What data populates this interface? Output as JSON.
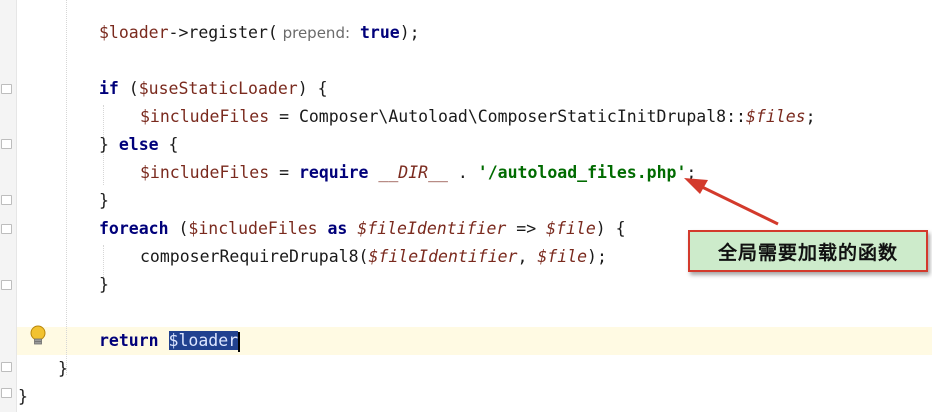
{
  "editor": {
    "code": {
      "l1_var": "$loader",
      "l1_arrow": "->register(",
      "l1_hint": " prepend:",
      "l1_true": " true",
      "l1_end": ");",
      "l2_if": "if",
      "l2_open": " (",
      "l2_var": "$useStaticLoader",
      "l2_close": ") {",
      "l3_var": "$includeFiles",
      "l3_eq": " = Composer\\Autoload\\ComposerStaticInitDrupal8::",
      "l3_files": "$files",
      "l3_end": ";",
      "l4_brace": "} ",
      "l4_else": "else",
      "l4_open": " {",
      "l5_var": "$includeFiles",
      "l5_eq": " = ",
      "l5_require": "require",
      "l5_dir": " __DIR__",
      "l5_dot": " . ",
      "l5_str": "'/autoload_files.php'",
      "l5_end": ";",
      "l6_close": "}",
      "l7_foreach": "foreach",
      "l7_open": " (",
      "l7_var1": "$includeFiles",
      "l7_as": " as ",
      "l7_var2": "$fileIdentifier",
      "l7_arrow": " => ",
      "l7_var3": "$file",
      "l7_close": ") {",
      "l8_fn": "composerRequireDrupal8(",
      "l8_var1": "$fileIdentifier",
      "l8_comma": ", ",
      "l8_var2": "$file",
      "l8_end": ");",
      "l9_close": "}",
      "l10_return": "return",
      "l10_var": "$loader",
      "l11_close": "}",
      "l12_close": "}"
    },
    "annotation": {
      "text": "全局需要加载的函数",
      "border_color": "#d33a2c",
      "fill_color": "#cdebcb"
    },
    "icons": {
      "lightbulb": "lightbulb-icon",
      "fold": "fold-marker-icon"
    }
  }
}
